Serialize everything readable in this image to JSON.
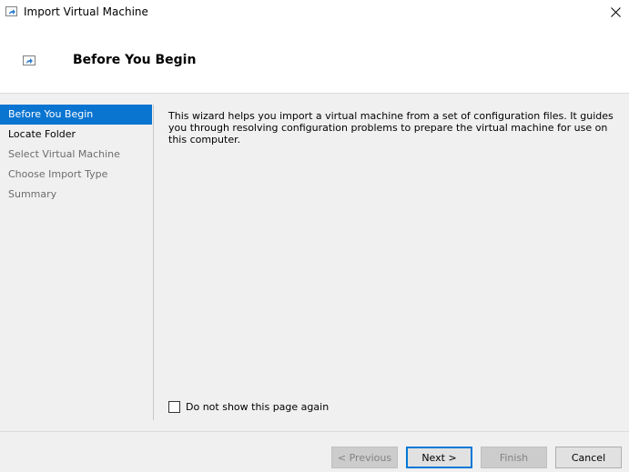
{
  "window": {
    "title": "Import Virtual Machine",
    "icon": "import-vm-icon",
    "close_icon": "close-icon"
  },
  "header": {
    "title": "Before You Begin",
    "icon": "import-vm-icon"
  },
  "sidebar": {
    "items": [
      {
        "label": "Before You Begin",
        "state": "active"
      },
      {
        "label": "Locate Folder",
        "state": "enabled"
      },
      {
        "label": "Select Virtual Machine",
        "state": "disabled"
      },
      {
        "label": "Choose Import Type",
        "state": "disabled"
      },
      {
        "label": "Summary",
        "state": "disabled"
      }
    ]
  },
  "content": {
    "description": "This wizard helps you import a virtual machine from a set of configuration files. It guides you through resolving configuration problems to prepare the virtual machine for use on this computer."
  },
  "checkbox": {
    "label": "Do not show this page again",
    "checked": false
  },
  "buttons": {
    "previous": "< Previous",
    "next": "Next >",
    "finish": "Finish",
    "cancel": "Cancel"
  },
  "colors": {
    "accent": "#0a74d1",
    "default_button_border": "#0078d7"
  }
}
